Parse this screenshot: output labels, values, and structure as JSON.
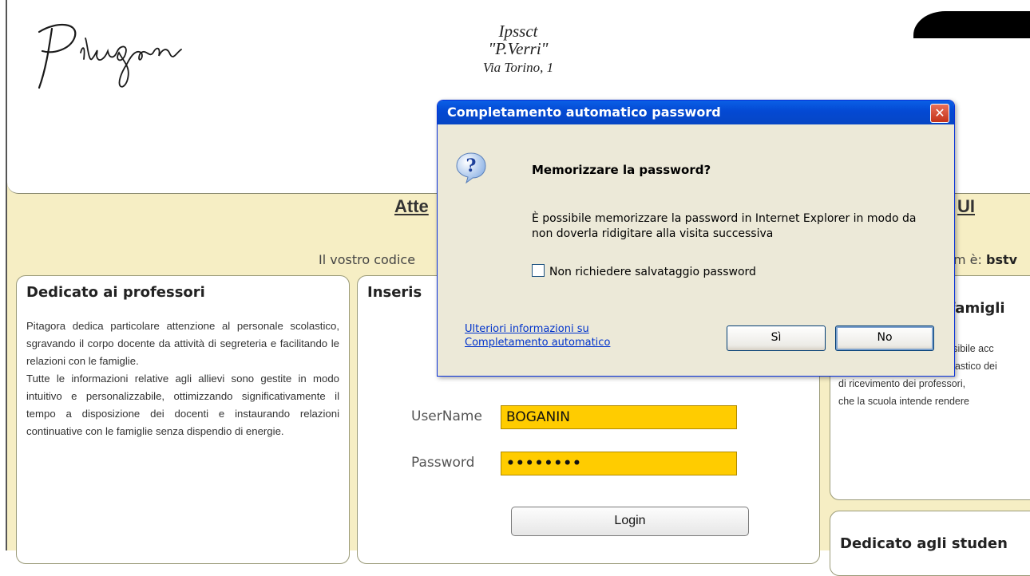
{
  "page": {
    "school": {
      "line1": "Ipssct",
      "line2": "\"P.Verri\"",
      "line3": "Via Torino, 1"
    },
    "title_left": "Atte",
    "title_right": "UI",
    "code_left": "Il vostro codice",
    "code_right_prefix": "m è: ",
    "code_right_bold": "bstv"
  },
  "left_panel": {
    "heading": "Dedicato ai professori",
    "text": "Pitagora dedica particolare attenzione al personale scolastico, sgravando il corpo docente da attività di segreteria e facilitando le relazioni con le famiglie.\nTutte le informazioni relative agli allievi sono gestite in modo intuitivo e personalizzabile, ottimizzando significativamente il tempo a disposizione dei docenti e instaurando relazioni continuative con le famiglie senza dispendio di energie."
  },
  "login_panel": {
    "heading": "Inseris",
    "username_label": "UserName",
    "username_value": "BOGANIN",
    "password_label": "Password",
    "password_mask": "••••••••",
    "login_label": "Login"
  },
  "right_panel": {
    "heading": "e famigli",
    "lines": [
      "ossibile acc",
      "colastico dei",
      "di ricevimento dei professori,",
      "che la scuola intende rendere"
    ]
  },
  "right_panel2": {
    "heading": "Dedicato agli studen"
  },
  "dialog": {
    "title": "Completamento automatico password",
    "close": "✕",
    "question_icon": "question-icon",
    "question": "Memorizzare la password?",
    "description": "È possibile memorizzare la password in Internet Explorer in modo da non doverla ridigitare alla visita successiva",
    "checkbox_label": "Non richiedere salvataggio password",
    "link_line1": "Ulteriori informazioni su",
    "link_line2": "Completamento automatico",
    "yes_label": "Sì",
    "no_label": "No"
  }
}
